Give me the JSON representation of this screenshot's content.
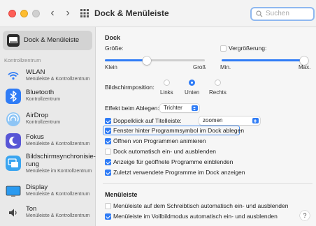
{
  "window": {
    "title": "Dock & Menüleiste",
    "search_placeholder": "Suchen"
  },
  "sidebar": {
    "selected": "Dock & Menüleiste",
    "section_label": "Kontrollzentrum",
    "items": [
      {
        "title": "WLAN",
        "subtitle": "Menüleiste & Kontrollzentrum",
        "icon": "wifi-icon"
      },
      {
        "title": "Bluetooth",
        "subtitle": "Kontrollzentrum",
        "icon": "bluetooth-icon"
      },
      {
        "title": "AirDrop",
        "subtitle": "Kontrollzentrum",
        "icon": "airdrop-icon"
      },
      {
        "title": "Fokus",
        "subtitle": "Menüleiste & Kontrollzentrum",
        "icon": "focus-moon-icon"
      },
      {
        "title": "Bildschirmsynchronisie-",
        "title2": "rung",
        "subtitle": "Menüleiste im Kontrollzentrum",
        "icon": "screen-mirroring-icon"
      },
      {
        "title": "Display",
        "subtitle": "Menüleiste & Kontrollzentrum",
        "icon": "display-icon"
      },
      {
        "title": "Ton",
        "subtitle": "Menüleiste & Kontrollzentrum",
        "icon": "sound-icon"
      }
    ]
  },
  "dock": {
    "heading": "Dock",
    "size_label": "Größe:",
    "size_min": "Klein",
    "size_max": "Groß",
    "size_value": 0.42,
    "magnification_label": "Vergrößerung:",
    "magnification_checked": false,
    "mag_min": "Min.",
    "mag_max": "Max.",
    "mag_value": 0.98,
    "position_label": "Bildschirmposition:",
    "positions": [
      "Links",
      "Unten",
      "Rechts"
    ],
    "position_selected": "Unten",
    "effect_label": "Effekt beim Ablegen:",
    "effect_value": "Trichter",
    "doubleclick_label": "Doppelklick auf Titelleiste:",
    "doubleclick_checked": true,
    "doubleclick_value": "zoomen",
    "options": [
      {
        "label": "Fenster hinter Programmsymbol im Dock ablegen",
        "checked": true
      },
      {
        "label": "Öffnen von Programmen animieren",
        "checked": true
      },
      {
        "label": "Dock automatisch ein- und ausblenden",
        "checked": false
      },
      {
        "label": "Anzeige für geöffnete Programme einblenden",
        "checked": true
      },
      {
        "label": "Zuletzt verwendete Programme im Dock anzeigen",
        "checked": true
      }
    ]
  },
  "menubar": {
    "heading": "Menüleiste",
    "options": [
      {
        "label": "Menüleiste auf dem Schreibtisch automatisch ein- und ausblenden",
        "checked": false
      },
      {
        "label": "Menüleiste im Vollbildmodus automatisch ein- und ausblenden",
        "checked": true
      }
    ]
  },
  "help_label": "?",
  "colors": {
    "accent": "#2f7cf6",
    "sidebar_selected": "#d3d3d3"
  }
}
